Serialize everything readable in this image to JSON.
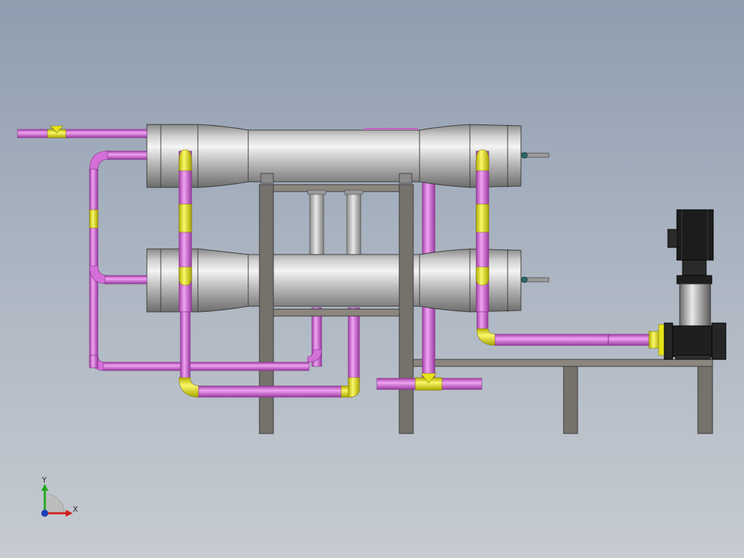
{
  "viewport": {
    "background_top": "#8f9db0",
    "background_bottom": "#c6cbd1"
  },
  "colors": {
    "pipe": "#d46fd8",
    "fitting": "#e6e31c",
    "frame": "#7a7670",
    "vessel": "#c9c9c9",
    "motor": "#1b1b1b"
  },
  "assembly": {
    "vessels": [
      "upper-membrane-housing",
      "lower-membrane-housing"
    ],
    "pump": "vertical-multistage-pump",
    "frame": "steel-support-frame"
  },
  "triad": {
    "x_label": "X",
    "y_label": "Y",
    "icon": "coordinate-triad-icon"
  }
}
